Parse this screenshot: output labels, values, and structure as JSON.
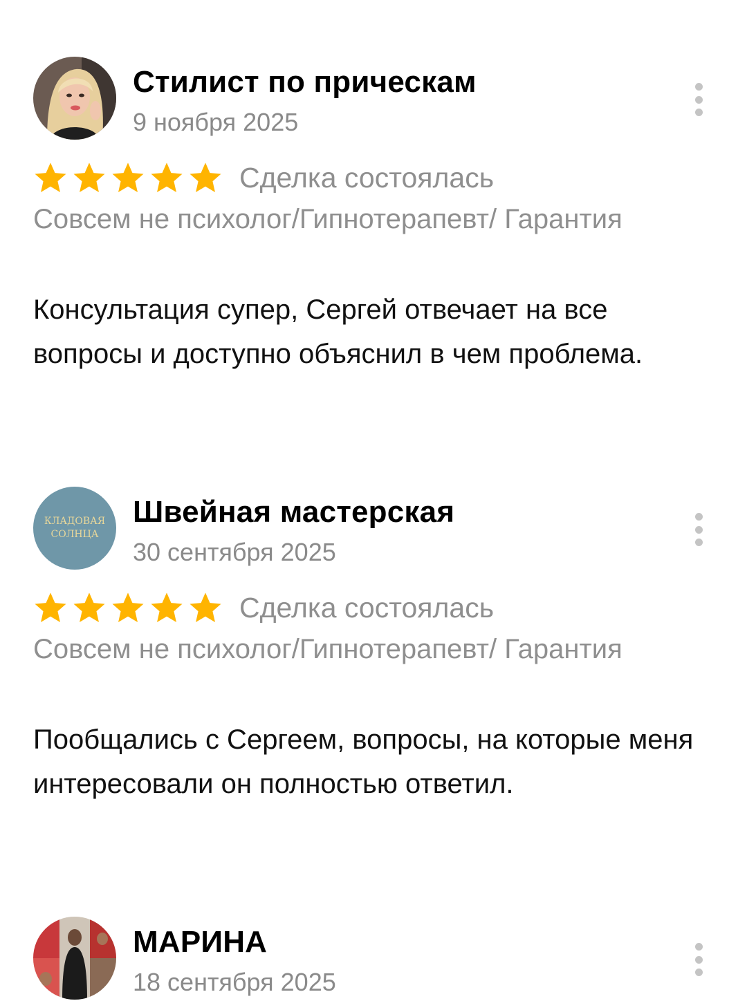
{
  "reviews": [
    {
      "author": "Стилист по прическам",
      "date": "9 ноября 2025",
      "rating": 5,
      "deal_status": "Сделка состоялась",
      "service": "Совсем не психолог/Гипнотерапевт/ Гарантия",
      "text": "Консультация супер, Сергей отвечает на все вопросы и доступно объяснил в чем проблема.",
      "avatar": "photo-avatar-woman-blonde"
    },
    {
      "author": "Швейная мастерская",
      "date": "30 сентября 2025",
      "rating": 5,
      "deal_status": "Сделка состоялась",
      "service": "Совсем не психолог/Гипнотерапевт/ Гарантия",
      "text": "Пообщались с Сергеем, вопросы, на которые меня интересовали он полностью ответил.",
      "avatar_lines": [
        "КЛАДОВАЯ",
        "СОЛНЦА"
      ]
    },
    {
      "author": "МАРИНА",
      "date": "18 сентября 2025",
      "avatar": "photo-avatar-collage"
    }
  ],
  "colors": {
    "star": "#FFB400",
    "secondary_text": "#8F8F8F",
    "menu_dots": "#C4C4C4",
    "avatar2_bg": "#6F97A8",
    "avatar2_text": "#E8D79A"
  }
}
